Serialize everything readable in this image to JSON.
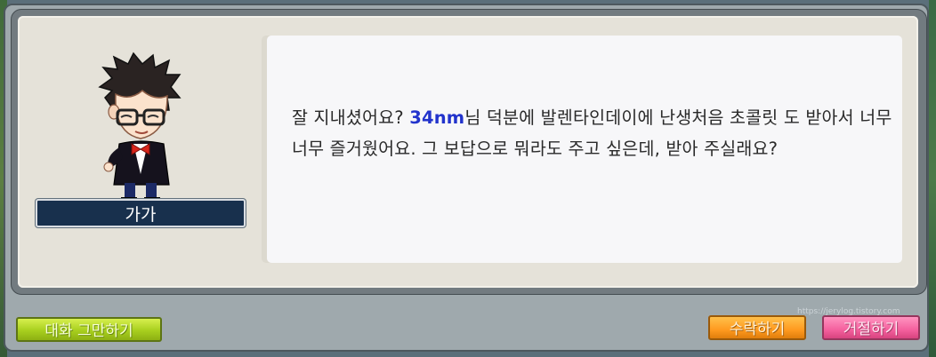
{
  "npc": {
    "name": "가가"
  },
  "dialog": {
    "text_before": "잘 지내셨어요? ",
    "player_name": "34nm",
    "text_after": "님 덕분에 발렌타인데이에 난생처음 초콜릿 도 받아서 너무너무 즐거웠어요. 그 보답으로 뭐라도 주고 싶은데, 받아 주실래요?"
  },
  "buttons": {
    "end_chat": "대화 그만하기",
    "accept": "수락하기",
    "decline": "거절하기"
  },
  "watermark": "https://jerylog.tistory.com",
  "colors": {
    "highlight": "#2233cc",
    "end_button": "#a8cf1e",
    "accept_button": "#ff9a1f",
    "decline_button": "#f4609e"
  }
}
